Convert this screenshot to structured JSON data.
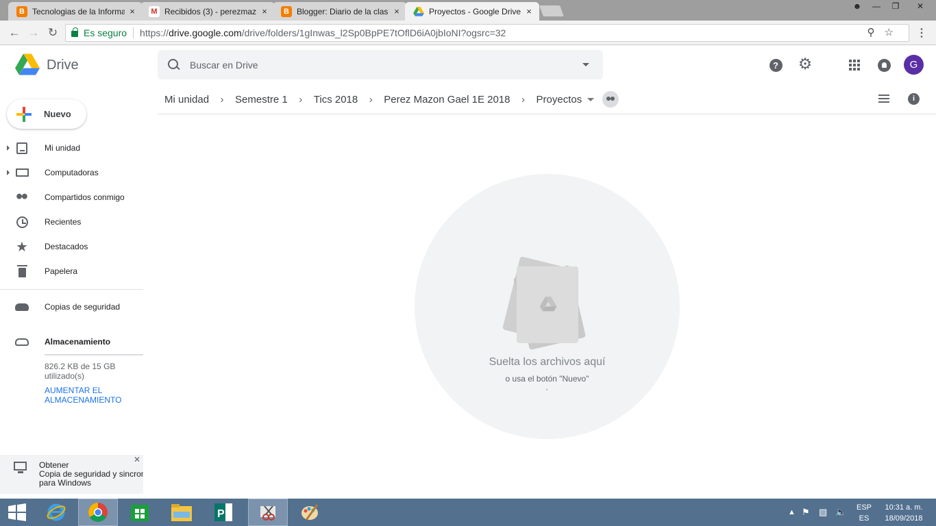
{
  "browser": {
    "tabs": [
      {
        "title": "Tecnologias de la Informa",
        "favicon": "blogger-icon",
        "color": "#f57d00"
      },
      {
        "title": "Recibidos (3) - perezmaz",
        "favicon": "gmail-icon",
        "color": "#d93025"
      },
      {
        "title": "Blogger: Diario de la clas",
        "favicon": "blogger-icon",
        "color": "#f57d00"
      },
      {
        "title": "Proyectos - Google Drive",
        "favicon": "drive-icon",
        "color": "#1a73e8"
      }
    ],
    "tab_close": "×",
    "secure_label": "Es seguro",
    "url_prefix": "https://",
    "url_host": "drive.google.com",
    "url_path": "/drive/folders/1gInwas_l2Sp0BpPE7tOflD6iA0jbIoNI?ogsrc=32"
  },
  "app": {
    "name": "Drive",
    "search_placeholder": "Buscar en Drive",
    "avatar_letter": "G",
    "avatar_color": "#5a2ea6"
  },
  "breadcrumb": [
    "Mi unidad",
    "Semestre 1",
    "Tics 2018",
    "Perez Mazon Gael 1E 2018",
    "Proyectos"
  ],
  "sidebar": {
    "new_label": "Nuevo",
    "items": [
      {
        "label": "Mi unidad",
        "icon": "my-drive-icon"
      },
      {
        "label": "Computadoras",
        "icon": "computers-icon"
      },
      {
        "label": "Compartidos conmigo",
        "icon": "shared-icon"
      },
      {
        "label": "Recientes",
        "icon": "clock-icon"
      },
      {
        "label": "Destacados",
        "icon": "star-icon"
      },
      {
        "label": "Papelera",
        "icon": "trash-icon"
      }
    ],
    "backups_label": "Copias de seguridad",
    "storage_label": "Almacenamiento",
    "storage_usage": "826.2 KB de 15 GB utilizado(s)",
    "storage_upgrade": "AUMENTAR EL ALMACENAMIENTO",
    "promo_title": "Obtener",
    "promo_line2": "Copia de seguridad y sincroni",
    "promo_line3": "para Windows"
  },
  "empty_state": {
    "title": "Suelta los archivos aquí",
    "subtitle": "o usa el botón \"Nuevo\""
  },
  "taskbar": {
    "lang_top": "ESP",
    "lang_bottom": "ES",
    "time": "10:31 a. m.",
    "date": "18/09/2018"
  }
}
